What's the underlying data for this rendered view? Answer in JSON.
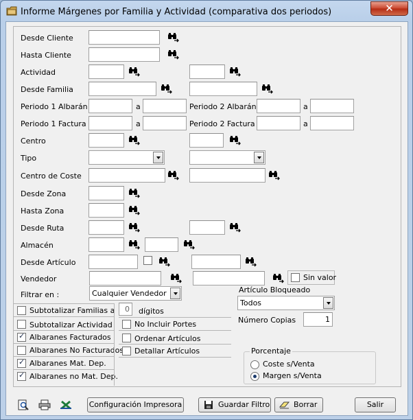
{
  "window": {
    "title": "Informe Márgenes por Familia y Actividad (comparativa dos periodos)",
    "close_glyph": "✕"
  },
  "form": {
    "desde_cliente": "Desde Cliente",
    "hasta_cliente": "Hasta Cliente",
    "actividad": "Actividad",
    "desde_familia": "Desde Familia",
    "periodo1_albaran": "Periodo 1 Albarán",
    "periodo2_albaran": "Periodo 2 Albarán",
    "periodo1_factura": "Periodo 1 Factura",
    "periodo2_factura": "Periodo 2 Factura",
    "a": "a",
    "centro": "Centro",
    "tipo": "Tipo",
    "centro_coste": "Centro de Coste",
    "desde_zona": "Desde Zona",
    "hasta_zona": "Hasta Zona",
    "desde_ruta": "Desde Ruta",
    "almacen": "Almacén",
    "desde_articulo": "Desde Artículo",
    "vendedor": "Vendedor",
    "sin_valor": "Sin valor",
    "filtrar_en": "Filtrar en :",
    "filtrar_value": "Cualquier Vendedor",
    "articulo_bloqueado": "Artículo Bloqueado",
    "articulo_bloqueado_value": "Todos",
    "numero_copias": "Número Copias",
    "numero_copias_value": "1",
    "digitos": "dígitos",
    "digitos_value": "0"
  },
  "options_left": [
    {
      "label": "Subtotalizar Familias a",
      "checked": false
    },
    {
      "label": "Subtotalizar Actividad",
      "checked": false
    },
    {
      "label": "Albaranes Facturados",
      "checked": true
    },
    {
      "label": "Albaranes No Facturados",
      "checked": false
    },
    {
      "label": "Albaranes Mat. Dep.",
      "checked": true
    },
    {
      "label": "Albaranes no Mat. Dep.",
      "checked": true
    }
  ],
  "options_right": [
    {
      "label": "No Incluir Portes",
      "checked": false
    },
    {
      "label": "Ordenar Artículos",
      "checked": false
    },
    {
      "label": "Detallar Artículos",
      "checked": false
    }
  ],
  "porcentaje": {
    "title": "Porcentaje",
    "options": [
      {
        "label": "Coste s/Venta",
        "selected": false
      },
      {
        "label": "Margen s/Venta",
        "selected": true
      }
    ]
  },
  "buttons": {
    "config": "Configuración Impresora",
    "guardar": "Guardar Filtro",
    "borrar": "Borrar",
    "salir": "Salir"
  },
  "icons": [
    "binoculars-icon",
    "preview-icon",
    "printer-icon",
    "excel-icon",
    "floppy-icon",
    "eraser-icon",
    "folder-icon"
  ]
}
